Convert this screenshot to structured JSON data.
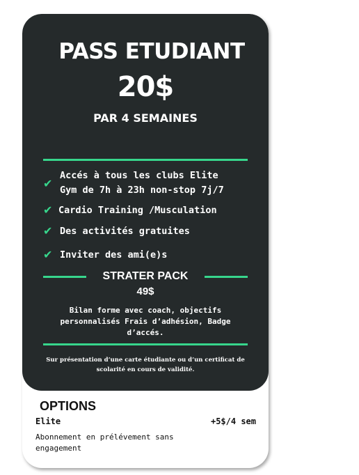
{
  "header": {
    "title": "PASS ETUDIANT",
    "price": "20$",
    "period": "PAR 4 SEMAINES"
  },
  "features": [
    {
      "line1": "Accés à tous les clubs Elite",
      "line2": "Gym de 7h à 23h non-stop 7j/7"
    },
    {
      "line1": "Cardio Training /Musculation"
    },
    {
      "line1": "Des activités gratuites"
    },
    {
      "line1": "Inviter des ami(e)s"
    }
  ],
  "starter_pack": {
    "title": "STRATER PACK",
    "price": "49$",
    "description": "Bilan forme avec coach, objectifs personnalisés Frais d’adhésion, Badge d’accés."
  },
  "note": "Sur présentation d’une carte étudiante ou d’un certificat de scolarité en cours de validité.",
  "options": {
    "title": "OPTIONS",
    "items": [
      {
        "name": "Elite",
        "price": "+5$/4 sem",
        "description": "Abonnement en prélévement sans engagement"
      }
    ]
  },
  "colors": {
    "card_dark": "#252a2b",
    "accent_green": "#37d68c",
    "text_light": "#ffffff",
    "text_dark": "#111111"
  }
}
